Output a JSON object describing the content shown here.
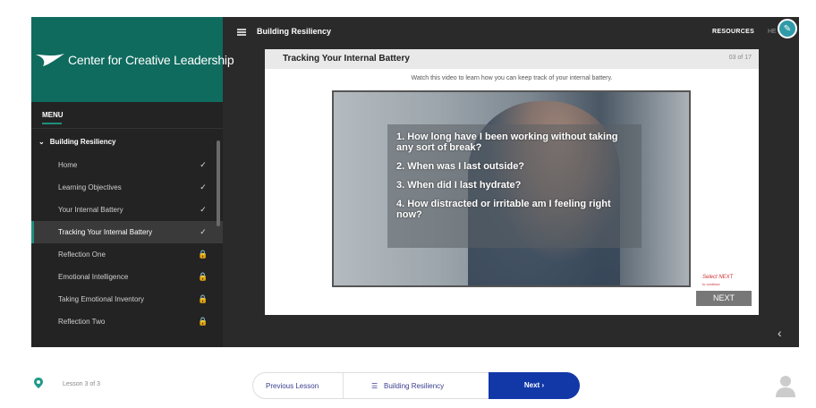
{
  "brand": {
    "name": "Center for Creative Leadership"
  },
  "sidebar": {
    "menu_label": "MENU",
    "section": "Building Resiliency",
    "items": [
      {
        "label": "Home",
        "status": "✓",
        "active": false
      },
      {
        "label": "Learning Objectives",
        "status": "✓",
        "active": false
      },
      {
        "label": "Your Internal Battery",
        "status": "✓",
        "active": false
      },
      {
        "label": "Tracking Your Internal Battery",
        "status": "✓",
        "active": true
      },
      {
        "label": "Reflection One",
        "status": "🔒",
        "active": false
      },
      {
        "label": "Emotional Intelligence",
        "status": "🔒",
        "active": false
      },
      {
        "label": "Taking Emotional Inventory",
        "status": "🔒",
        "active": false
      },
      {
        "label": "Reflection Two",
        "status": "🔒",
        "active": false
      }
    ]
  },
  "topbar": {
    "course_title": "Building Resiliency",
    "resources": "RESOURCES",
    "help": "HE"
  },
  "slide": {
    "title": "Tracking Your Internal Battery",
    "count": "03 of 17",
    "subtitle": "Watch this video to learn how you can keep track of your internal battery.",
    "questions": [
      "1. How long have I been working without taking any sort of break?",
      "2. When was I last outside?",
      "3. When did I last hydrate?",
      "4. How distracted or irritable am I feeling right now?"
    ],
    "select_next": "Select NEXT",
    "select_next_sub": "to continue",
    "next": "NEXT"
  },
  "bottom": {
    "lesson": "Lesson 3 of 3",
    "previous": "Previous Lesson",
    "crumb": "Building Resiliency",
    "next": "Next ›"
  },
  "colors": {
    "brand": "#0f6b5e",
    "accent": "#1f8f7d",
    "next_button": "#1238a8"
  }
}
